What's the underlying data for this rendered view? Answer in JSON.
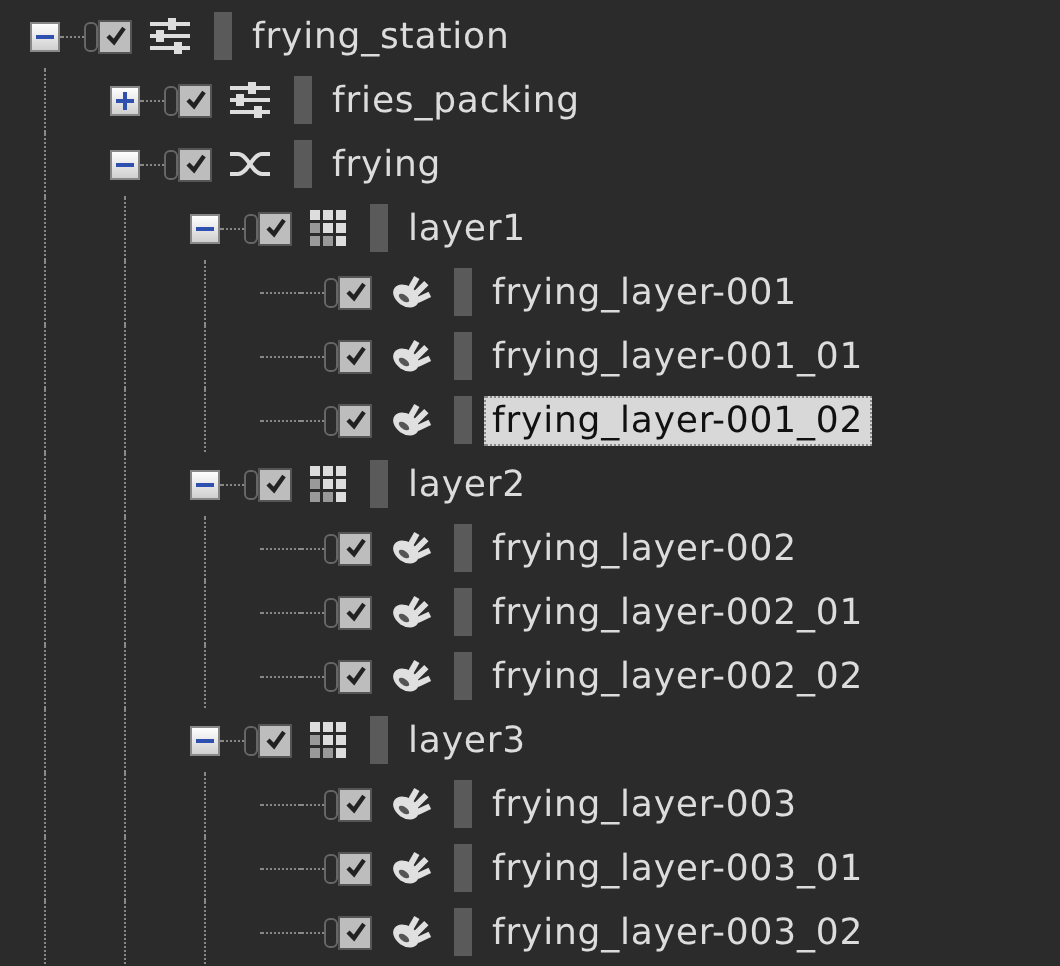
{
  "tree": [
    {
      "label": "frying_station",
      "kind": "group",
      "checked": true,
      "expanded": true,
      "selected": false,
      "children": [
        {
          "label": "fries_packing",
          "kind": "group",
          "checked": true,
          "expanded": false,
          "selected": false
        },
        {
          "label": "frying",
          "kind": "switch",
          "checked": true,
          "expanded": true,
          "selected": false,
          "children": [
            {
              "label": "layer1",
              "kind": "layer",
              "checked": true,
              "expanded": true,
              "selected": false,
              "children": [
                {
                  "label": "frying_layer-001",
                  "kind": "item",
                  "checked": true,
                  "selected": false
                },
                {
                  "label": "frying_layer-001_01",
                  "kind": "item",
                  "checked": true,
                  "selected": false
                },
                {
                  "label": "frying_layer-001_02",
                  "kind": "item",
                  "checked": true,
                  "selected": true
                }
              ]
            },
            {
              "label": "layer2",
              "kind": "layer",
              "checked": true,
              "expanded": true,
              "selected": false,
              "children": [
                {
                  "label": "frying_layer-002",
                  "kind": "item",
                  "checked": true,
                  "selected": false
                },
                {
                  "label": "frying_layer-002_01",
                  "kind": "item",
                  "checked": true,
                  "selected": false
                },
                {
                  "label": "frying_layer-002_02",
                  "kind": "item",
                  "checked": true,
                  "selected": false
                }
              ]
            },
            {
              "label": "layer3",
              "kind": "layer",
              "checked": true,
              "expanded": true,
              "selected": false,
              "children": [
                {
                  "label": "frying_layer-003",
                  "kind": "item",
                  "checked": true,
                  "selected": false
                },
                {
                  "label": "frying_layer-003_01",
                  "kind": "item",
                  "checked": true,
                  "selected": false
                },
                {
                  "label": "frying_layer-003_02",
                  "kind": "item",
                  "checked": true,
                  "selected": false
                }
              ]
            }
          ]
        }
      ]
    }
  ]
}
